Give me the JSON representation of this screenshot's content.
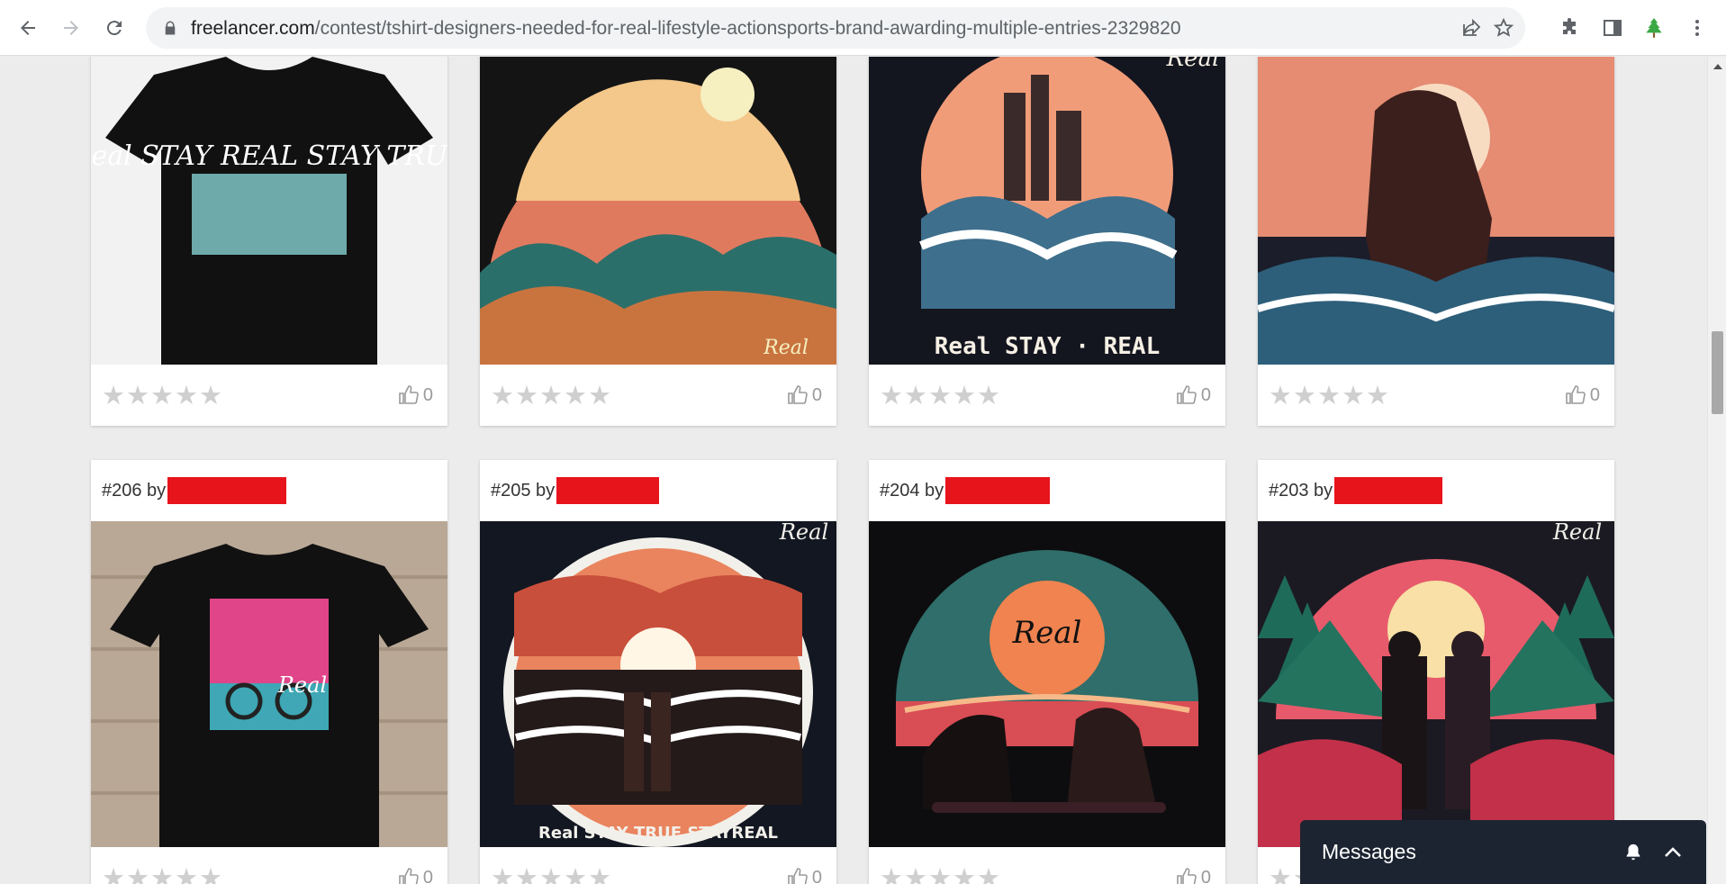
{
  "browser": {
    "url_host": "freelancer.com",
    "url_path": "/contest/tshirt-designers-needed-for-real-lifestyle-actionsports-brand-awarding-multiple-entries-2329820"
  },
  "entries_top": [
    {
      "likes": "0",
      "rating_stars": "★★★★★",
      "art": "Real STAY REAL STAY TRUE"
    },
    {
      "likes": "0",
      "rating_stars": "★★★★★",
      "art": "Real"
    },
    {
      "likes": "0",
      "rating_stars": "★★★★★",
      "art": "Real STAY · REAL"
    },
    {
      "likes": "0",
      "rating_stars": "★★★★★",
      "art": ""
    }
  ],
  "entries_bottom": [
    {
      "title": "#206 by",
      "likes": "0",
      "rating_stars": "★★★★★",
      "art": "Real"
    },
    {
      "title": "#205 by",
      "likes": "0",
      "rating_stars": "★★★★★",
      "art": "Real STAY TRUE STAYREAL"
    },
    {
      "title": "#204 by",
      "likes": "0",
      "rating_stars": "★★★★★",
      "art": "Real"
    },
    {
      "title": "#203 by",
      "likes": "0",
      "rating_stars": "★★★★★",
      "art": "Real"
    }
  ],
  "messages": {
    "label": "Messages"
  },
  "colors": {
    "redaction": "#e8141c",
    "messages_bg": "#1c2431",
    "page_bg": "#ececec"
  }
}
